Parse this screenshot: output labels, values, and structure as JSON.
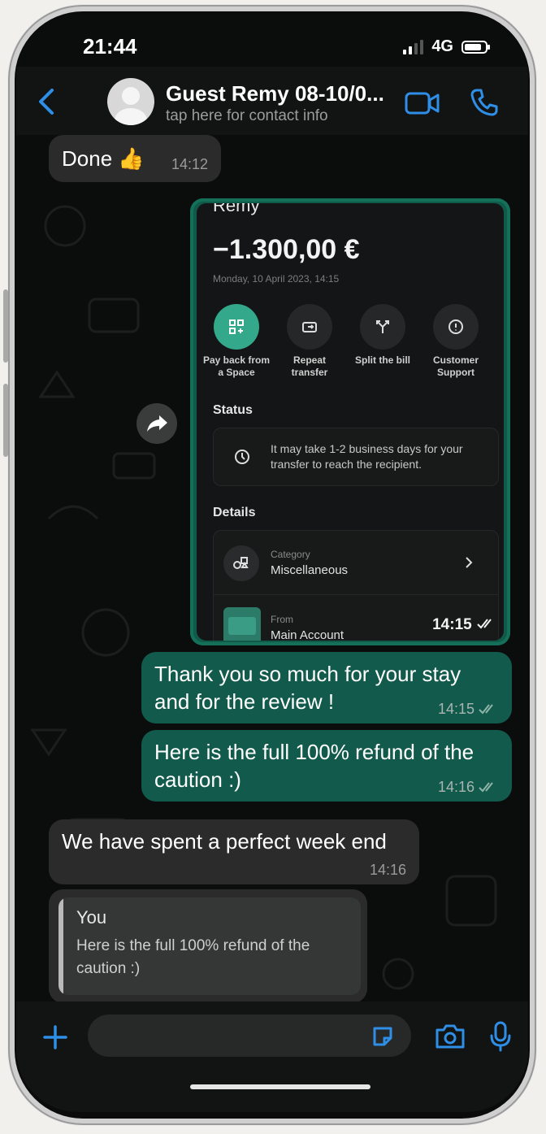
{
  "status_bar": {
    "time": "21:44",
    "network": "4G"
  },
  "header": {
    "contact_name": "Guest Remy 08-10/0...",
    "contact_subtitle": "tap here for contact info",
    "accent_color": "#2f8fe6"
  },
  "messages": {
    "done": {
      "text": "Done 👍",
      "time": "14:12"
    },
    "image": {
      "time": "14:15",
      "receipt": {
        "name": "Remy",
        "amount": "−1.300,00 €",
        "date": "Monday, 10 April 2023, 14:15",
        "actions": [
          {
            "label": "Pay back from a Space"
          },
          {
            "label": "Repeat transfer"
          },
          {
            "label": "Split the bill"
          },
          {
            "label": "Customer Support"
          }
        ],
        "status_title": "Status",
        "status_text": "It may take 1-2 business days for your transfer to reach the recipient.",
        "details_title": "Details",
        "category_label": "Category",
        "category_value": "Miscellaneous",
        "from_label": "From",
        "from_value": "Main Account"
      }
    },
    "thanks": {
      "text": "Thank you so much for your stay and for the review !",
      "time": "14:15"
    },
    "refund": {
      "text": "Here is the full 100% refund of the caution :)",
      "time": "14:16"
    },
    "weekend": {
      "text": "We have spent a perfect week end",
      "time": "14:16"
    },
    "reply_quote": {
      "author": "You",
      "text": "Here is the full 100% refund of the caution :)"
    }
  },
  "colors": {
    "outgoing_bubble": "#125b4c",
    "incoming_bubble": "#2b2b2c",
    "icon_blue": "#2f8fe6"
  }
}
